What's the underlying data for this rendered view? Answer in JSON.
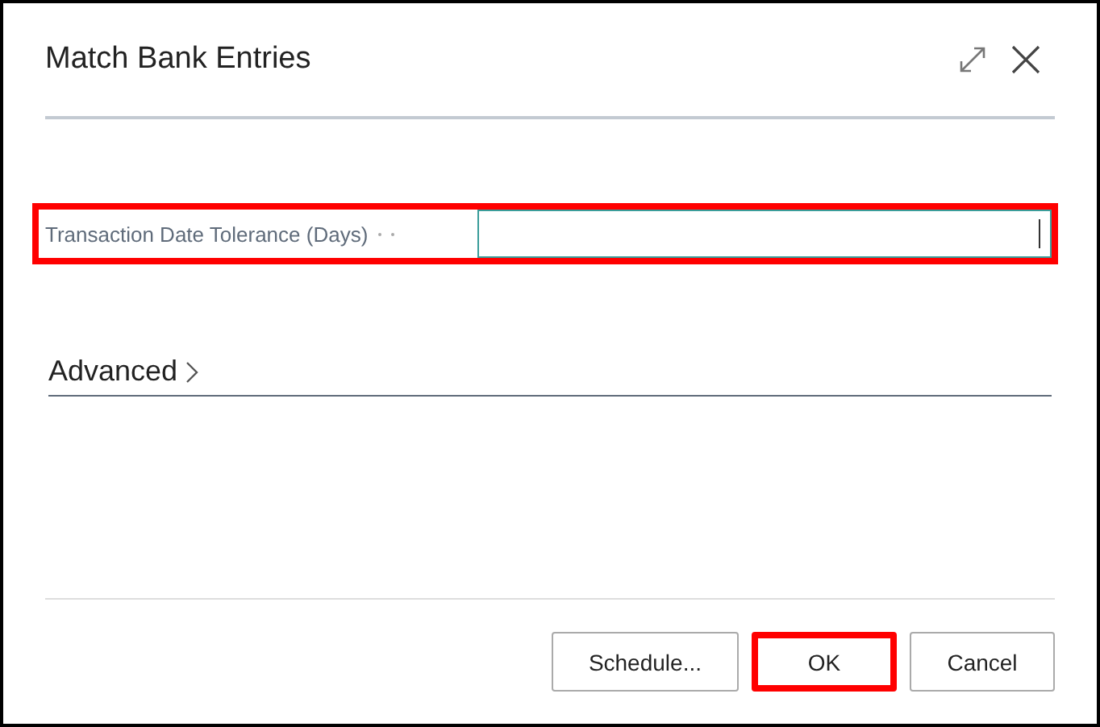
{
  "window": {
    "title": "Match Bank Entries"
  },
  "fields": [
    {
      "label": "Transaction Date Tolerance (Days)",
      "focused": true,
      "highlighted": true
    }
  ],
  "section": {
    "title": "Advanced",
    "expanded": false
  },
  "buttons": [
    {
      "label": "Schedule...",
      "highlighted": false
    },
    {
      "label": "OK",
      "highlighted": true
    },
    {
      "label": "Cancel",
      "highlighted": false
    }
  ]
}
